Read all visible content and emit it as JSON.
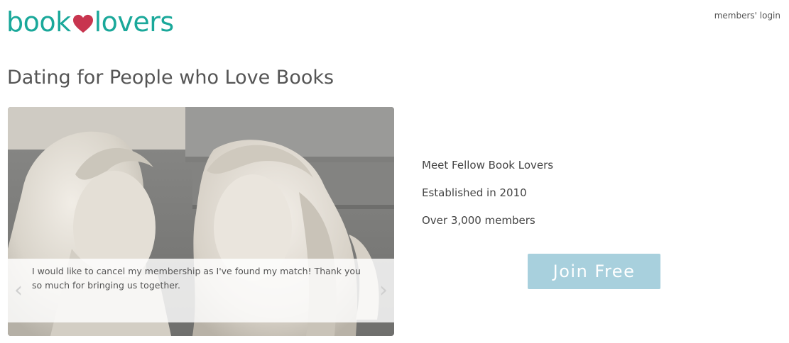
{
  "header": {
    "logo_left": "book",
    "logo_right": "lovers",
    "login_label": "members' login"
  },
  "page_title": "Dating for People who Love Books",
  "slider": {
    "caption": "I would like to cancel my membership as I've found my match! Thank you so much for bringing us together.",
    "prev_icon": "chevron-left-icon",
    "next_icon": "chevron-right-icon"
  },
  "features": [
    "Meet Fellow Book Lovers",
    "Established in 2010",
    "Over 3,000 members"
  ],
  "join_label": "Join Free",
  "colors": {
    "brand_teal": "#1aa89a",
    "heart_red": "#c8354f",
    "join_button": "#a8d0dd"
  }
}
